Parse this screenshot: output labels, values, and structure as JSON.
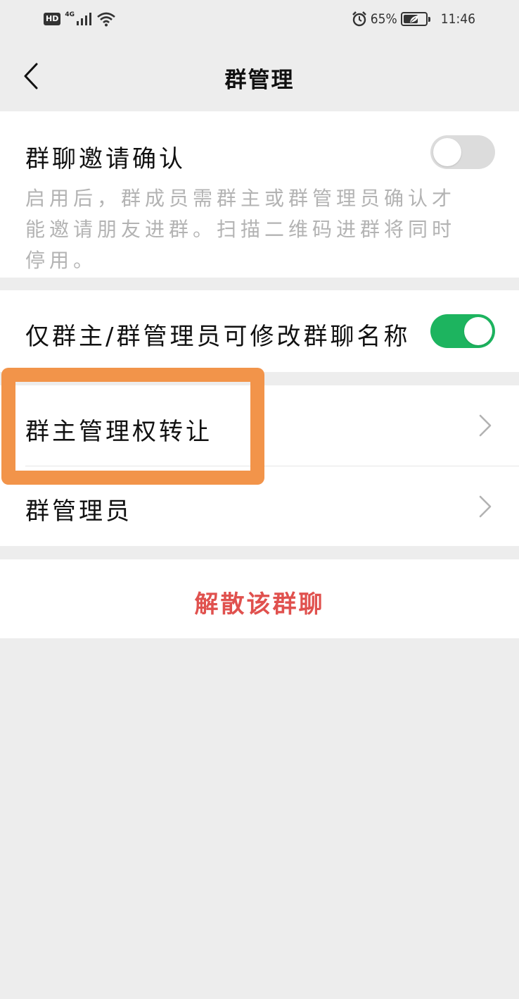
{
  "status_bar": {
    "hd": "HD",
    "network": "4G",
    "battery_text": "65%",
    "battery_level": 0.65,
    "time": "11:46"
  },
  "nav": {
    "title": "群管理"
  },
  "invite_confirm": {
    "title": "群聊邀请确认",
    "description": "启用后，群成员需群主或群管理员确认才能邀请朋友进群。扫描二维码进群将同时停用。",
    "enabled": false
  },
  "rename_restrict": {
    "title": "仅群主/群管理员可修改群聊名称",
    "enabled": true
  },
  "menu": {
    "transfer_owner": "群主管理权转让",
    "admins": "群管理员"
  },
  "dissolve": {
    "label": "解散该群聊"
  },
  "colors": {
    "background": "#ededed",
    "accent_green": "#1db45f",
    "danger_red": "#e0514e",
    "highlight_orange": "#f2944a"
  }
}
